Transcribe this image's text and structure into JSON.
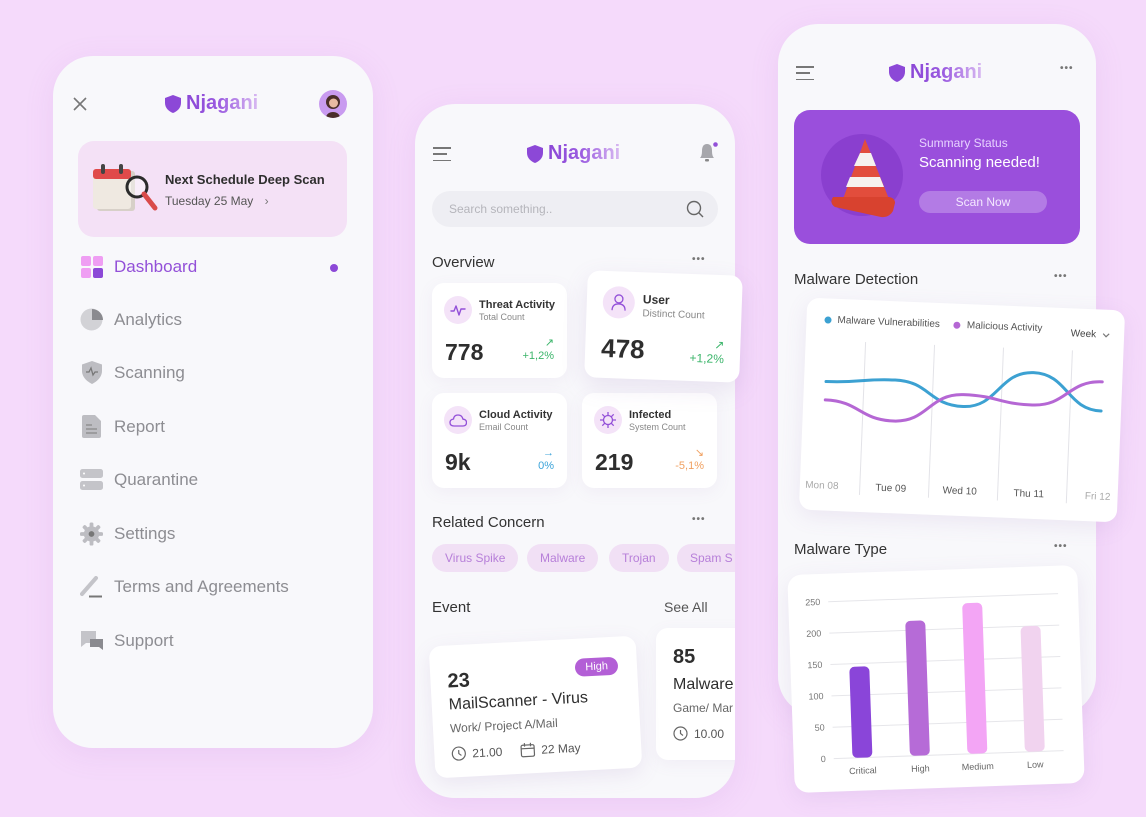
{
  "brand": {
    "name": "Njagani",
    "accent": "#9350d8",
    "background": "#f5dafb"
  },
  "menu_screen": {
    "close_icon": "close-icon",
    "avatar_icon": "user-avatar",
    "schedule": {
      "title": "Next Schedule Deep Scan",
      "date": "Tuesday 25 May",
      "chevron": "›"
    },
    "nav": [
      {
        "label": "Dashboard",
        "icon": "dashboard-icon",
        "active": true
      },
      {
        "label": "Analytics",
        "icon": "pie-chart-icon",
        "active": false
      },
      {
        "label": "Scanning",
        "icon": "shield-pulse-icon",
        "active": false
      },
      {
        "label": "Report",
        "icon": "document-icon",
        "active": false
      },
      {
        "label": "Quarantine",
        "icon": "server-icon",
        "active": false
      },
      {
        "label": "Settings",
        "icon": "gear-icon",
        "active": false
      },
      {
        "label": "Terms and Agreements",
        "icon": "pen-icon",
        "active": false
      },
      {
        "label": "Support",
        "icon": "chat-icon",
        "active": false
      }
    ]
  },
  "home_screen": {
    "search_placeholder": "Search something..",
    "overview": {
      "title": "Overview",
      "more": "•••",
      "stats": [
        {
          "title": "Threat Activity",
          "subtitle": "Total Count",
          "value": "778",
          "change": "+1,2%",
          "arrow": "↗",
          "trend": "up",
          "color": "#3bb56a"
        },
        {
          "title": "User",
          "subtitle": "Distinct Count",
          "value": "478",
          "change": "+1,2%",
          "arrow": "↗",
          "trend": "up",
          "color": "#3bb56a"
        },
        {
          "title": "Cloud Activity",
          "subtitle": "Email Count",
          "value": "9k",
          "change": "0%",
          "arrow": "→",
          "trend": "flat",
          "color": "#3ba3d9"
        },
        {
          "title": "Infected",
          "subtitle": "System Count",
          "value": "219",
          "change": "-5,1%",
          "arrow": "↘",
          "trend": "down",
          "color": "#f0a060"
        }
      ]
    },
    "related": {
      "title": "Related Concern",
      "more": "•••",
      "chips": [
        "Virus Spike",
        "Malware",
        "Trojan",
        "Spam S"
      ]
    },
    "events": {
      "title": "Event",
      "see_all": "See All",
      "items": [
        {
          "number": "23",
          "badge": "High",
          "name": "MailScanner - Virus",
          "path": "Work/ Project A/Mail",
          "time": "21.00",
          "date": "22 May"
        },
        {
          "number": "85",
          "name": "Malware",
          "path": "Game/ Mar",
          "time": "10.00"
        }
      ]
    }
  },
  "status_screen": {
    "more": "•••",
    "summary": {
      "label": "Summary Status",
      "status": "Scanning needed!",
      "button": "Scan Now"
    },
    "detection_title": "Malware Detection",
    "type_title": "Malware Type",
    "period_select": "Week"
  },
  "chart_data": [
    {
      "type": "line",
      "title": "Malware Detection",
      "categories": [
        "Mon 08",
        "Tue 09",
        "Wed 10",
        "Thu 11",
        "Fri 12"
      ],
      "series": [
        {
          "name": "Malware Vulnerabilities",
          "color": "#3ca1d2",
          "values": [
            62,
            66,
            44,
            78,
            45
          ]
        },
        {
          "name": "Malicious Activity",
          "color": "#b567d4",
          "values": [
            45,
            28,
            55,
            48,
            72
          ]
        }
      ],
      "legend": "top-left",
      "grid": true
    },
    {
      "type": "bar",
      "title": "Malware Type",
      "categories": [
        "Critical",
        "High",
        "Medium",
        "Low"
      ],
      "values": [
        145,
        215,
        240,
        200
      ],
      "colors": [
        "#8a45d9",
        "#b66bd7",
        "#f3a5f5",
        "#f1d3ef"
      ],
      "yticks": [
        0,
        50,
        100,
        150,
        200,
        250
      ],
      "ylim": [
        0,
        250
      ],
      "grid": true
    }
  ]
}
